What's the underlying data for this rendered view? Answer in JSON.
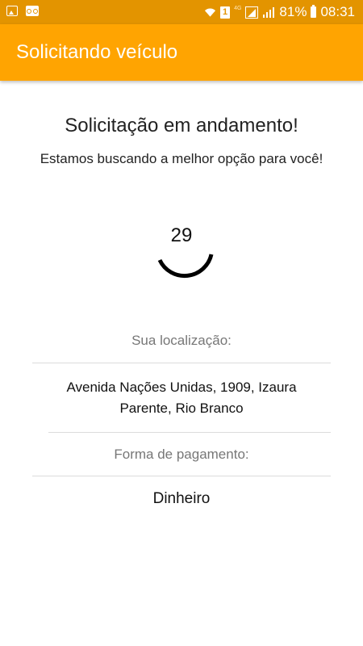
{
  "status_bar": {
    "battery_percent": "81%",
    "time": "08:31",
    "sim_label": "1",
    "network_label": "4G",
    "icons": [
      "image-icon",
      "voicemail-icon",
      "wifi-icon",
      "sim-icon",
      "signal-icon",
      "signal-icon",
      "battery-icon"
    ]
  },
  "app_bar": {
    "title": "Solicitando veículo",
    "color": "#ffa401"
  },
  "main": {
    "heading": "Solicitação em andamento!",
    "subheading": "Estamos buscando a melhor opção para você!",
    "countdown": "29"
  },
  "location": {
    "label": "Sua localização:",
    "address_line1": "Avenida Nações Unidas, 1909, Izaura",
    "address_line2": "Parente, Rio Branco"
  },
  "payment": {
    "label": "Forma de pagamento:",
    "value": "Dinheiro"
  },
  "colors": {
    "status_bar": "#e39400",
    "accent": "#ffa401",
    "label_text": "#777777",
    "divider": "#dcdcdc"
  }
}
